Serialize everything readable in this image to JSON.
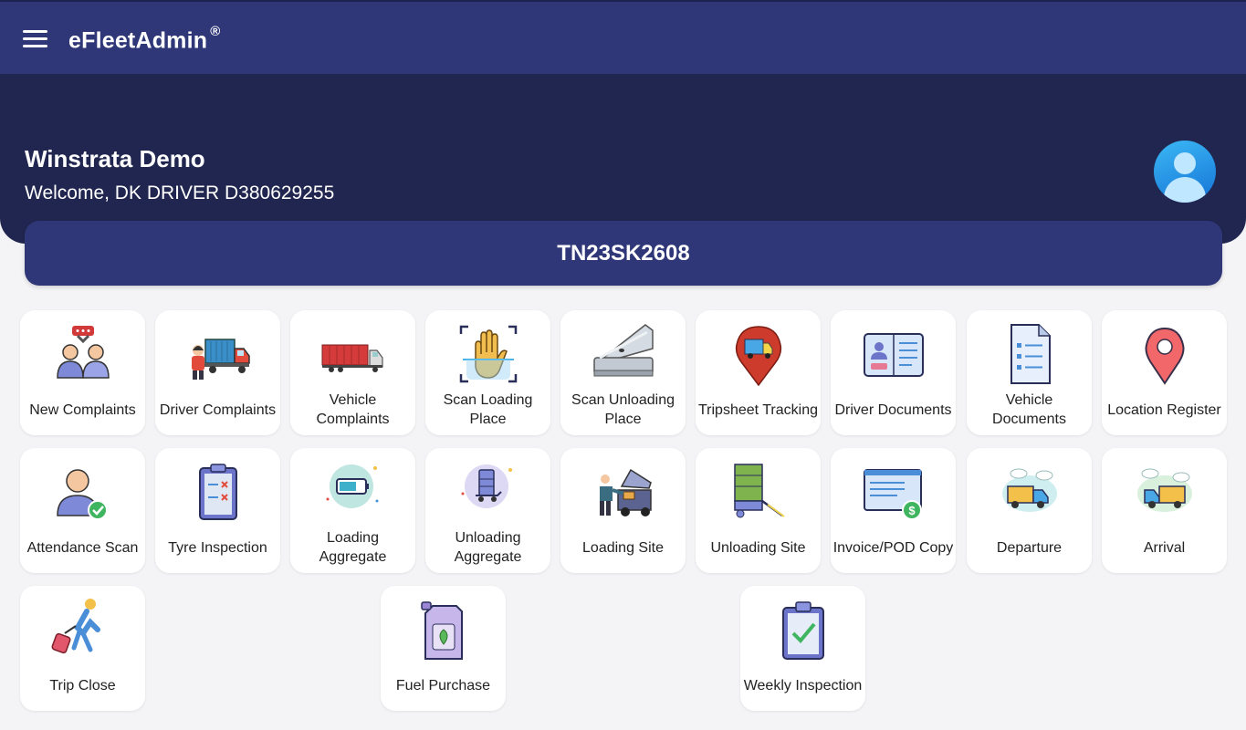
{
  "app": {
    "title": "eFleetAdmin",
    "reg_mark": "®"
  },
  "header": {
    "company": "Winstrata Demo",
    "welcome": "Welcome, DK DRIVER D380629255"
  },
  "vehicle": {
    "number": "TN23SK2608"
  },
  "tiles": [
    {
      "label": "New Complaints",
      "icon": "complaints-icon"
    },
    {
      "label": "Driver Complaints",
      "icon": "driver-truck-icon"
    },
    {
      "label": "Vehicle Complaints",
      "icon": "trailer-truck-icon"
    },
    {
      "label": "Scan Loading Place",
      "icon": "hand-scan-icon"
    },
    {
      "label": "Scan Unloading Place",
      "icon": "scanner-icon"
    },
    {
      "label": "Tripsheet Tracking",
      "icon": "truck-pin-icon"
    },
    {
      "label": "Driver Documents",
      "icon": "id-card-icon"
    },
    {
      "label": "Vehicle Documents",
      "icon": "document-icon"
    },
    {
      "label": "Location Register",
      "icon": "location-pin-icon"
    },
    {
      "label": "Attendance Scan",
      "icon": "user-check-icon"
    },
    {
      "label": "Tyre Inspection",
      "icon": "clipboard-x-icon"
    },
    {
      "label": "Loading Aggregate",
      "icon": "battery-loading-icon"
    },
    {
      "label": "Unloading Aggregate",
      "icon": "trolley-unload-icon"
    },
    {
      "label": "Loading Site",
      "icon": "car-loading-icon"
    },
    {
      "label": "Unloading Site",
      "icon": "cart-unload-icon"
    },
    {
      "label": "Invoice/POD Copy",
      "icon": "invoice-icon"
    },
    {
      "label": "Departure",
      "icon": "truck-departure-icon"
    },
    {
      "label": "Arrival",
      "icon": "truck-arrival-icon"
    },
    {
      "label": "Trip Close",
      "icon": "traveler-icon"
    },
    {
      "label": "Fuel Purchase",
      "icon": "fuel-can-icon"
    },
    {
      "label": "Weekly Inspection",
      "icon": "clipboard-check-icon"
    }
  ]
}
